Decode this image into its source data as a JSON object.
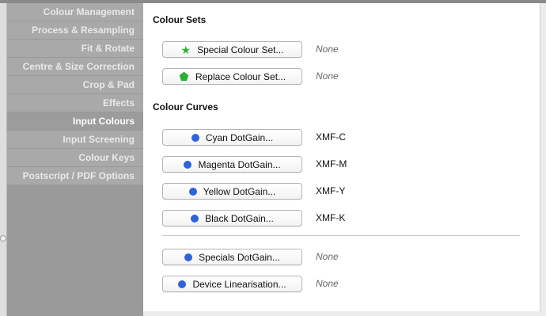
{
  "sidebar": {
    "items": [
      {
        "label": "Colour Management"
      },
      {
        "label": "Process & Resampling"
      },
      {
        "label": "Fit & Rotate"
      },
      {
        "label": "Centre & Size Correction"
      },
      {
        "label": "Crop & Pad"
      },
      {
        "label": "Effects"
      },
      {
        "label": "Input Colours"
      },
      {
        "label": "Input Screening"
      },
      {
        "label": "Colour Keys"
      },
      {
        "label": "Postscript / PDF Options"
      }
    ],
    "active": "Input Colours"
  },
  "colour_sets": {
    "heading": "Colour Sets",
    "special_label": "Special Colour Set...",
    "special_icon": "star-icon",
    "special_value": "None",
    "replace_label": "Replace Colour Set...",
    "replace_icon": "pentagon-icon",
    "replace_value": "None"
  },
  "colour_curves": {
    "heading": "Colour Curves",
    "cyan_label": "Cyan DotGain...",
    "cyan_value": "XMF-C",
    "magenta_label": "Magenta DotGain...",
    "magenta_value": "XMF-M",
    "yellow_label": "Yellow DotGain...",
    "yellow_value": "XMF-Y",
    "black_label": "Black DotGain...",
    "black_value": "XMF-K",
    "specials_label": "Specials DotGain...",
    "specials_value": "None",
    "device_label": "Device Linearisation...",
    "device_value": "None"
  },
  "colors": {
    "dot_blue": "#2f63d4",
    "star_green": "#2cae3a",
    "pentagon_green": "#2cae3a"
  }
}
